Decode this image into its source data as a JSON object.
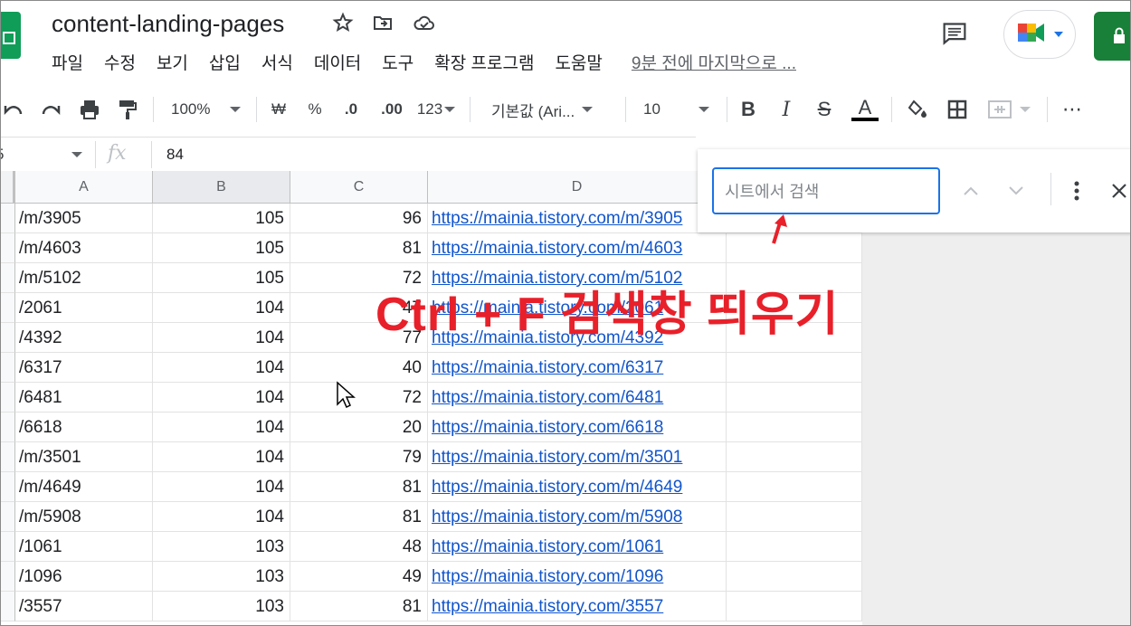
{
  "app": {
    "doc_title": "content-landing-pages",
    "menu": [
      "파일",
      "수정",
      "보기",
      "삽입",
      "서식",
      "데이터",
      "도구",
      "확장 프로그램",
      "도움말"
    ],
    "last_edit": "9분 전에 마지막으로 ..."
  },
  "toolbar": {
    "zoom": "100%",
    "currency": "₩",
    "percent": "%",
    "decrease_decimal": ".0",
    "increase_decimal": ".00",
    "number_format": "123",
    "font": "기본값 (Ari...",
    "font_size": "10",
    "bold": "B",
    "italic": "I",
    "strike": "S",
    "text_color": "A",
    "more": "⋯"
  },
  "formula_bar": {
    "name_box": "5",
    "fx": "fx",
    "value": "84"
  },
  "columns": [
    "A",
    "B",
    "C",
    "D"
  ],
  "rows": [
    {
      "a": "/m/3905",
      "b": "105",
      "c": "96",
      "d": "https://mainia.tistory.com/m/3905"
    },
    {
      "a": "/m/4603",
      "b": "105",
      "c": "81",
      "d": "https://mainia.tistory.com/m/4603"
    },
    {
      "a": "/m/5102",
      "b": "105",
      "c": "72",
      "d": "https://mainia.tistory.com/m/5102"
    },
    {
      "a": "/2061",
      "b": "104",
      "c": "47",
      "d": "https://mainia.tistory.com/2061"
    },
    {
      "a": "/4392",
      "b": "104",
      "c": "77",
      "d": "https://mainia.tistory.com/4392"
    },
    {
      "a": "/6317",
      "b": "104",
      "c": "40",
      "d": "https://mainia.tistory.com/6317"
    },
    {
      "a": "/6481",
      "b": "104",
      "c": "72",
      "d": "https://mainia.tistory.com/6481"
    },
    {
      "a": "/6618",
      "b": "104",
      "c": "20",
      "d": "https://mainia.tistory.com/6618"
    },
    {
      "a": "/m/3501",
      "b": "104",
      "c": "79",
      "d": "https://mainia.tistory.com/m/3501"
    },
    {
      "a": "/m/4649",
      "b": "104",
      "c": "81",
      "d": "https://mainia.tistory.com/m/4649"
    },
    {
      "a": "/m/5908",
      "b": "104",
      "c": "81",
      "d": "https://mainia.tistory.com/m/5908"
    },
    {
      "a": "/1061",
      "b": "103",
      "c": "48",
      "d": "https://mainia.tistory.com/1061"
    },
    {
      "a": "/1096",
      "b": "103",
      "c": "49",
      "d": "https://mainia.tistory.com/1096"
    },
    {
      "a": "/3557",
      "b": "103",
      "c": "81",
      "d": "https://mainia.tistory.com/3557"
    }
  ],
  "find": {
    "placeholder": "시트에서 검색"
  },
  "annotation": {
    "text": "Ctrl + F 검색창 띄우기",
    "color": "#e8202a"
  },
  "colors": {
    "accent": "#1a73e8",
    "link": "#1155cc",
    "sheets_green": "#0f9d58"
  }
}
